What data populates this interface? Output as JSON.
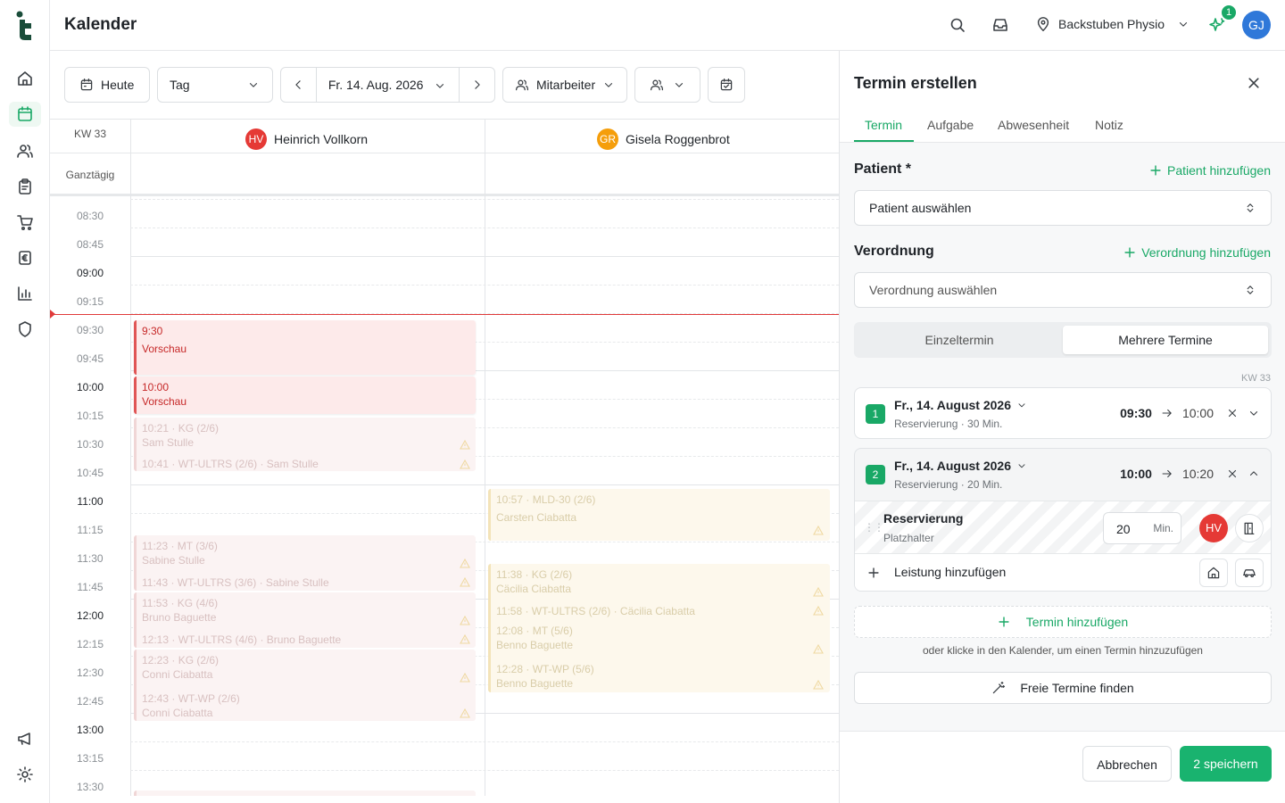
{
  "app": {
    "title": "Kalender"
  },
  "topbar": {
    "location": "Backstuben Physio",
    "notification_count": "1",
    "user_initials": "GJ"
  },
  "toolbar": {
    "today_label": "Heute",
    "view_value": "Tag",
    "date_value": "Fr. 14. Aug. 2026",
    "staff_label": "Mitarbeiter"
  },
  "calendar": {
    "week_label": "KW 33",
    "allday_label": "Ganztägig",
    "employees": [
      {
        "initials": "HV",
        "name": "Heinrich Vollkorn",
        "color": "#e53935"
      },
      {
        "initials": "GR",
        "name": "Gisela Roggenbrot",
        "color": "#f59e0b"
      }
    ],
    "times": [
      "08:30",
      "08:45",
      "09:00",
      "09:15",
      "09:30",
      "09:45",
      "10:00",
      "10:15",
      "10:30",
      "10:45",
      "11:00",
      "11:15",
      "11:30",
      "11:45",
      "12:00",
      "12:15",
      "12:30",
      "12:45",
      "13:00",
      "13:15",
      "13:30"
    ],
    "events_col1": [
      {
        "time": "9:30",
        "title": "Vorschau"
      },
      {
        "time": "10:00",
        "title": "Vorschau"
      },
      {
        "line1": "10:21 · KG (2/6)",
        "line2": "Sam Stulle",
        "line3": "10:41 · WT-ULTRS (2/6) · Sam Stulle"
      },
      {
        "line1": "11:23 · MT (3/6)",
        "line2": "Sabine Stulle",
        "line3": "11:43 · WT-ULTRS (3/6) · Sabine Stulle"
      },
      {
        "line1": "11:53 · KG (4/6)",
        "line2": "Bruno Baguette",
        "line3": "12:13 · WT-ULTRS (4/6) · Bruno Baguette"
      },
      {
        "line1": "12:23 · KG (2/6)",
        "line2": "Conni Ciabatta",
        "line3": "12:43 · WT-WP (2/6)",
        "line4": "Conni Ciabatta"
      }
    ],
    "events_col2": [
      {
        "line1": "10:57 · MLD-30 (2/6)",
        "line2": "Carsten Ciabatta"
      },
      {
        "line1": "11:38 · KG (2/6)",
        "line2": "Cäcilia Ciabatta",
        "line3": "11:58 · WT-ULTRS (2/6) · Cäcilia Ciabatta",
        "line4": "12:08 · MT (5/6)",
        "line5": "Benno Baguette",
        "line6": "12:28 · WT-WP (5/6)",
        "line7": "Benno Baguette"
      }
    ]
  },
  "panel": {
    "title": "Termin erstellen",
    "tabs": [
      "Termin",
      "Aufgabe",
      "Abwesenheit",
      "Notiz"
    ],
    "patient_label": "Patient *",
    "patient_add": "Patient hinzufügen",
    "patient_placeholder": "Patient auswählen",
    "rx_label": "Verordnung",
    "rx_add": "Verordnung hinzufügen",
    "rx_placeholder": "Verordnung auswählen",
    "mode_single": "Einzeltermin",
    "mode_multi": "Mehrere Termine",
    "week_hint": "KW 33",
    "appointments": [
      {
        "num": "1",
        "date": "Fr., 14. August 2026",
        "sub": "Reservierung · 30 Min.",
        "start": "09:30",
        "end": "10:00"
      },
      {
        "num": "2",
        "date": "Fr., 14. August 2026",
        "sub": "Reservierung · 20 Min.",
        "start": "10:00",
        "end": "10:20"
      }
    ],
    "service": {
      "name": "Reservierung",
      "sub": "Platzhalter",
      "minutes": "20",
      "unit": "Min.",
      "therapist": "HV"
    },
    "add_service": "Leistung hinzufügen",
    "add_appointment": "Termin hinzufügen",
    "hint": "oder klicke in den Kalender, um einen Termin hinzuzufügen",
    "find_free": "Freie Termine finden",
    "cancel": "Abbrechen",
    "save": "2 speichern"
  }
}
